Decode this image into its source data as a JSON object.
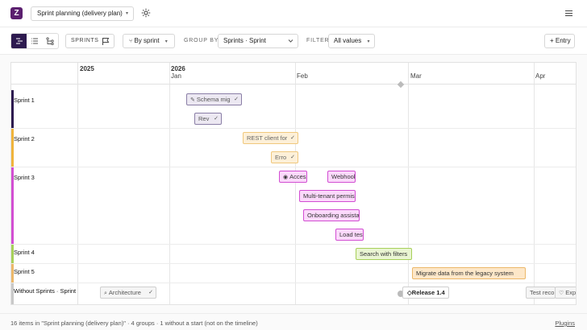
{
  "app": {
    "view_name": "Sprint planning (delivery plan)"
  },
  "toolbar": {
    "sprints_label": "SPRINTS",
    "by_sprint_label": "By sprint",
    "group_by_label": "GROUP BY",
    "group_by_value": "Sprints · Sprint",
    "filter_label": "FILTER",
    "filter_value": "All values",
    "entry_label": "+ Entry"
  },
  "timeline": {
    "years": [
      "2025",
      "2026"
    ],
    "months": [
      "Jan",
      "Feb",
      "Mar",
      "Apr"
    ],
    "groups": [
      {
        "name": "Sprint 1",
        "color": "#2d1a4f"
      },
      {
        "name": "Sprint 2",
        "color": "#f0b43c"
      },
      {
        "name": "Sprint 3",
        "color": "#d24ed2"
      },
      {
        "name": "Sprint 4",
        "color": "#a7d05a"
      },
      {
        "name": "Sprint 5",
        "color": "#ecb86a"
      },
      {
        "name": "Without Sprints · Sprint",
        "color": "#c9c9c9"
      }
    ],
    "items": [
      {
        "label": "Schema mig"
      },
      {
        "label": "Rev"
      },
      {
        "label": "REST client for"
      },
      {
        "label": "Erro"
      },
      {
        "label": "Access"
      },
      {
        "label": "Webhook"
      },
      {
        "label": "Multi-tenant permiss"
      },
      {
        "label": "Onboarding assistan"
      },
      {
        "label": "Load test"
      },
      {
        "label": "Search with filters"
      },
      {
        "label": "Migrate data from the legacy system"
      },
      {
        "label": "Architecture"
      },
      {
        "label": "Release 1.4"
      },
      {
        "label": "Test reco"
      },
      {
        "label": "Expl"
      }
    ]
  },
  "footer": {
    "status": "16 items in \"Sprint planning (delivery plan)\" · 4 groups · 1 without a start (not on the timeline)",
    "plugins": "Plugins"
  }
}
